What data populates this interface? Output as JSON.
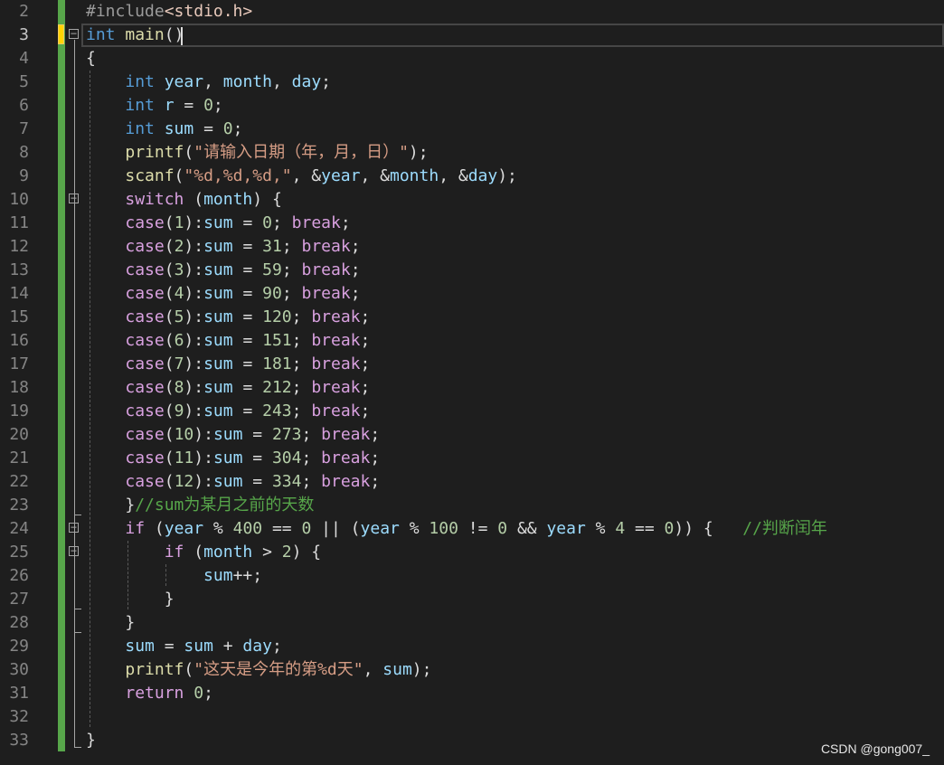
{
  "editor": {
    "lines": [
      {
        "n": "2",
        "tokens": [
          [
            "pp",
            "#include"
          ],
          [
            "inc",
            "<stdio.h>"
          ]
        ]
      },
      {
        "n": "3",
        "tokens": [
          [
            "kw",
            "int"
          ],
          [
            "plain",
            " "
          ],
          [
            "fn",
            "main"
          ],
          [
            "plain",
            "()"
          ]
        ]
      },
      {
        "n": "4",
        "tokens": [
          [
            "plain",
            "{"
          ]
        ]
      },
      {
        "n": "5",
        "tokens": [
          [
            "plain",
            "    "
          ],
          [
            "kw",
            "int"
          ],
          [
            "plain",
            " "
          ],
          [
            "var",
            "year"
          ],
          [
            "plain",
            ", "
          ],
          [
            "var",
            "month"
          ],
          [
            "plain",
            ", "
          ],
          [
            "var",
            "day"
          ],
          [
            "plain",
            ";"
          ]
        ]
      },
      {
        "n": "6",
        "tokens": [
          [
            "plain",
            "    "
          ],
          [
            "kw",
            "int"
          ],
          [
            "plain",
            " "
          ],
          [
            "var",
            "r"
          ],
          [
            "plain",
            " = "
          ],
          [
            "num",
            "0"
          ],
          [
            "plain",
            ";"
          ]
        ]
      },
      {
        "n": "7",
        "tokens": [
          [
            "plain",
            "    "
          ],
          [
            "kw",
            "int"
          ],
          [
            "plain",
            " "
          ],
          [
            "var",
            "sum"
          ],
          [
            "plain",
            " = "
          ],
          [
            "num",
            "0"
          ],
          [
            "plain",
            ";"
          ]
        ]
      },
      {
        "n": "8",
        "tokens": [
          [
            "plain",
            "    "
          ],
          [
            "fn",
            "printf"
          ],
          [
            "plain",
            "("
          ],
          [
            "str",
            "\"请输入日期（年，月，日）\""
          ],
          [
            "plain",
            ");"
          ]
        ]
      },
      {
        "n": "9",
        "tokens": [
          [
            "plain",
            "    "
          ],
          [
            "fn",
            "scanf"
          ],
          [
            "plain",
            "("
          ],
          [
            "str",
            "\"%d,%d,%d,\""
          ],
          [
            "plain",
            ", &"
          ],
          [
            "var",
            "year"
          ],
          [
            "plain",
            ", &"
          ],
          [
            "var",
            "month"
          ],
          [
            "plain",
            ", &"
          ],
          [
            "var",
            "day"
          ],
          [
            "plain",
            ");"
          ]
        ]
      },
      {
        "n": "10",
        "tokens": [
          [
            "plain",
            "    "
          ],
          [
            "ctl",
            "switch"
          ],
          [
            "plain",
            " ("
          ],
          [
            "var",
            "month"
          ],
          [
            "plain",
            ") {"
          ]
        ]
      },
      {
        "n": "11",
        "tokens": [
          [
            "plain",
            "    "
          ],
          [
            "ctl",
            "case"
          ],
          [
            "plain",
            "("
          ],
          [
            "num",
            "1"
          ],
          [
            "plain",
            "):"
          ],
          [
            "var",
            "sum"
          ],
          [
            "plain",
            " = "
          ],
          [
            "num",
            "0"
          ],
          [
            "plain",
            "; "
          ],
          [
            "ctl",
            "break"
          ],
          [
            "plain",
            ";"
          ]
        ]
      },
      {
        "n": "12",
        "tokens": [
          [
            "plain",
            "    "
          ],
          [
            "ctl",
            "case"
          ],
          [
            "plain",
            "("
          ],
          [
            "num",
            "2"
          ],
          [
            "plain",
            "):"
          ],
          [
            "var",
            "sum"
          ],
          [
            "plain",
            " = "
          ],
          [
            "num",
            "31"
          ],
          [
            "plain",
            "; "
          ],
          [
            "ctl",
            "break"
          ],
          [
            "plain",
            ";"
          ]
        ]
      },
      {
        "n": "13",
        "tokens": [
          [
            "plain",
            "    "
          ],
          [
            "ctl",
            "case"
          ],
          [
            "plain",
            "("
          ],
          [
            "num",
            "3"
          ],
          [
            "plain",
            "):"
          ],
          [
            "var",
            "sum"
          ],
          [
            "plain",
            " = "
          ],
          [
            "num",
            "59"
          ],
          [
            "plain",
            "; "
          ],
          [
            "ctl",
            "break"
          ],
          [
            "plain",
            ";"
          ]
        ]
      },
      {
        "n": "14",
        "tokens": [
          [
            "plain",
            "    "
          ],
          [
            "ctl",
            "case"
          ],
          [
            "plain",
            "("
          ],
          [
            "num",
            "4"
          ],
          [
            "plain",
            "):"
          ],
          [
            "var",
            "sum"
          ],
          [
            "plain",
            " = "
          ],
          [
            "num",
            "90"
          ],
          [
            "plain",
            "; "
          ],
          [
            "ctl",
            "break"
          ],
          [
            "plain",
            ";"
          ]
        ]
      },
      {
        "n": "15",
        "tokens": [
          [
            "plain",
            "    "
          ],
          [
            "ctl",
            "case"
          ],
          [
            "plain",
            "("
          ],
          [
            "num",
            "5"
          ],
          [
            "plain",
            "):"
          ],
          [
            "var",
            "sum"
          ],
          [
            "plain",
            " = "
          ],
          [
            "num",
            "120"
          ],
          [
            "plain",
            "; "
          ],
          [
            "ctl",
            "break"
          ],
          [
            "plain",
            ";"
          ]
        ]
      },
      {
        "n": "16",
        "tokens": [
          [
            "plain",
            "    "
          ],
          [
            "ctl",
            "case"
          ],
          [
            "plain",
            "("
          ],
          [
            "num",
            "6"
          ],
          [
            "plain",
            "):"
          ],
          [
            "var",
            "sum"
          ],
          [
            "plain",
            " = "
          ],
          [
            "num",
            "151"
          ],
          [
            "plain",
            "; "
          ],
          [
            "ctl",
            "break"
          ],
          [
            "plain",
            ";"
          ]
        ]
      },
      {
        "n": "17",
        "tokens": [
          [
            "plain",
            "    "
          ],
          [
            "ctl",
            "case"
          ],
          [
            "plain",
            "("
          ],
          [
            "num",
            "7"
          ],
          [
            "plain",
            "):"
          ],
          [
            "var",
            "sum"
          ],
          [
            "plain",
            " = "
          ],
          [
            "num",
            "181"
          ],
          [
            "plain",
            "; "
          ],
          [
            "ctl",
            "break"
          ],
          [
            "plain",
            ";"
          ]
        ]
      },
      {
        "n": "18",
        "tokens": [
          [
            "plain",
            "    "
          ],
          [
            "ctl",
            "case"
          ],
          [
            "plain",
            "("
          ],
          [
            "num",
            "8"
          ],
          [
            "plain",
            "):"
          ],
          [
            "var",
            "sum"
          ],
          [
            "plain",
            " = "
          ],
          [
            "num",
            "212"
          ],
          [
            "plain",
            "; "
          ],
          [
            "ctl",
            "break"
          ],
          [
            "plain",
            ";"
          ]
        ]
      },
      {
        "n": "19",
        "tokens": [
          [
            "plain",
            "    "
          ],
          [
            "ctl",
            "case"
          ],
          [
            "plain",
            "("
          ],
          [
            "num",
            "9"
          ],
          [
            "plain",
            "):"
          ],
          [
            "var",
            "sum"
          ],
          [
            "plain",
            " = "
          ],
          [
            "num",
            "243"
          ],
          [
            "plain",
            "; "
          ],
          [
            "ctl",
            "break"
          ],
          [
            "plain",
            ";"
          ]
        ]
      },
      {
        "n": "20",
        "tokens": [
          [
            "plain",
            "    "
          ],
          [
            "ctl",
            "case"
          ],
          [
            "plain",
            "("
          ],
          [
            "num",
            "10"
          ],
          [
            "plain",
            "):"
          ],
          [
            "var",
            "sum"
          ],
          [
            "plain",
            " = "
          ],
          [
            "num",
            "273"
          ],
          [
            "plain",
            "; "
          ],
          [
            "ctl",
            "break"
          ],
          [
            "plain",
            ";"
          ]
        ]
      },
      {
        "n": "21",
        "tokens": [
          [
            "plain",
            "    "
          ],
          [
            "ctl",
            "case"
          ],
          [
            "plain",
            "("
          ],
          [
            "num",
            "11"
          ],
          [
            "plain",
            "):"
          ],
          [
            "var",
            "sum"
          ],
          [
            "plain",
            " = "
          ],
          [
            "num",
            "304"
          ],
          [
            "plain",
            "; "
          ],
          [
            "ctl",
            "break"
          ],
          [
            "plain",
            ";"
          ]
        ]
      },
      {
        "n": "22",
        "tokens": [
          [
            "plain",
            "    "
          ],
          [
            "ctl",
            "case"
          ],
          [
            "plain",
            "("
          ],
          [
            "num",
            "12"
          ],
          [
            "plain",
            "):"
          ],
          [
            "var",
            "sum"
          ],
          [
            "plain",
            " = "
          ],
          [
            "num",
            "334"
          ],
          [
            "plain",
            "; "
          ],
          [
            "ctl",
            "break"
          ],
          [
            "plain",
            ";"
          ]
        ]
      },
      {
        "n": "23",
        "tokens": [
          [
            "plain",
            "    }"
          ],
          [
            "cmt",
            "//sum为某月之前的天数"
          ]
        ]
      },
      {
        "n": "24",
        "tokens": [
          [
            "plain",
            "    "
          ],
          [
            "ctl",
            "if"
          ],
          [
            "plain",
            " ("
          ],
          [
            "var",
            "year"
          ],
          [
            "plain",
            " % "
          ],
          [
            "num",
            "400"
          ],
          [
            "plain",
            " == "
          ],
          [
            "num",
            "0"
          ],
          [
            "plain",
            " || ("
          ],
          [
            "var",
            "year"
          ],
          [
            "plain",
            " % "
          ],
          [
            "num",
            "100"
          ],
          [
            "plain",
            " != "
          ],
          [
            "num",
            "0"
          ],
          [
            "plain",
            " && "
          ],
          [
            "var",
            "year"
          ],
          [
            "plain",
            " % "
          ],
          [
            "num",
            "4"
          ],
          [
            "plain",
            " == "
          ],
          [
            "num",
            "0"
          ],
          [
            "plain",
            ")) {   "
          ],
          [
            "cmt",
            "//判断闰年"
          ]
        ]
      },
      {
        "n": "25",
        "tokens": [
          [
            "plain",
            "        "
          ],
          [
            "ctl",
            "if"
          ],
          [
            "plain",
            " ("
          ],
          [
            "var",
            "month"
          ],
          [
            "plain",
            " > "
          ],
          [
            "num",
            "2"
          ],
          [
            "plain",
            ") {"
          ]
        ]
      },
      {
        "n": "26",
        "tokens": [
          [
            "plain",
            "            "
          ],
          [
            "var",
            "sum"
          ],
          [
            "plain",
            "++;"
          ]
        ]
      },
      {
        "n": "27",
        "tokens": [
          [
            "plain",
            "        }"
          ]
        ]
      },
      {
        "n": "28",
        "tokens": [
          [
            "plain",
            "    }"
          ]
        ]
      },
      {
        "n": "29",
        "tokens": [
          [
            "plain",
            "    "
          ],
          [
            "var",
            "sum"
          ],
          [
            "plain",
            " = "
          ],
          [
            "var",
            "sum"
          ],
          [
            "plain",
            " + "
          ],
          [
            "var",
            "day"
          ],
          [
            "plain",
            ";"
          ]
        ]
      },
      {
        "n": "30",
        "tokens": [
          [
            "plain",
            "    "
          ],
          [
            "fn",
            "printf"
          ],
          [
            "plain",
            "("
          ],
          [
            "str",
            "\"这天是今年的第%d天\""
          ],
          [
            "plain",
            ", "
          ],
          [
            "var",
            "sum"
          ],
          [
            "plain",
            ");"
          ]
        ]
      },
      {
        "n": "31",
        "tokens": [
          [
            "plain",
            "    "
          ],
          [
            "ctl",
            "return"
          ],
          [
            "plain",
            " "
          ],
          [
            "num",
            "0"
          ],
          [
            "plain",
            ";"
          ]
        ]
      },
      {
        "n": "32",
        "tokens": []
      },
      {
        "n": "33",
        "tokens": [
          [
            "plain",
            "}"
          ]
        ]
      }
    ],
    "active_line": "3",
    "fold_lines": [
      "3",
      "10",
      "24",
      "25"
    ]
  },
  "watermark": "CSDN @gong007_",
  "colors": {
    "background": "#1e1e1e",
    "keyword": "#569cd6",
    "control": "#d8a0df",
    "function": "#dcdcaa",
    "string": "#d69d85",
    "number": "#b5cea8",
    "variable": "#9cdcfe",
    "comment": "#57a64a",
    "change_bar": "#57a64a"
  }
}
